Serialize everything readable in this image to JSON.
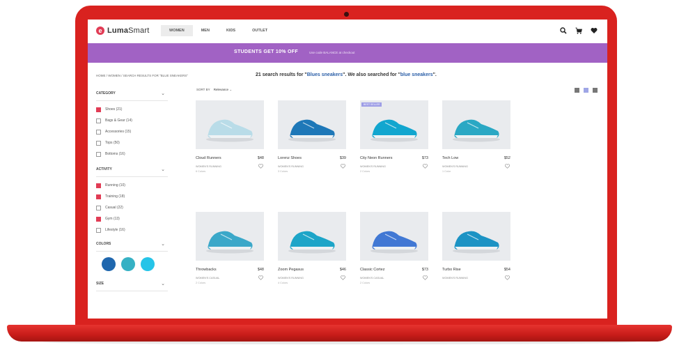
{
  "site": {
    "logo_initial": "e",
    "logo_text_bold": "Luma",
    "logo_text": "Smart",
    "nav": [
      {
        "label": "Women",
        "active": true
      },
      {
        "label": "Men",
        "active": false
      },
      {
        "label": "Kids",
        "active": false
      },
      {
        "label": "Outlet",
        "active": false
      }
    ],
    "icons": [
      "search-icon",
      "cart-icon",
      "heart-icon"
    ]
  },
  "promo": {
    "title": "STUDENTS GET 10% OFF",
    "subtitle": "Use code BALANCE at checkout"
  },
  "breadcrumb": "HOME / WOMEN / SEARCH RESULTS FOR \"BLUE SNEAKERS\"",
  "results": {
    "prefix": "21 search results for \"",
    "query": "Blues sneakers",
    "middle": "\". We also searched for \"",
    "suggest": "blue sneakers",
    "suffix": "\"."
  },
  "sort": {
    "label": "SORT BY",
    "value": "Relevance"
  },
  "filters": {
    "category": {
      "title": "Category",
      "options": [
        {
          "label": "Shoes (21)",
          "checked": true
        },
        {
          "label": "Bags & Gear (14)",
          "checked": false
        },
        {
          "label": "Accessories (15)",
          "checked": false
        },
        {
          "label": "Tops (50)",
          "checked": false
        },
        {
          "label": "Bottoms (16)",
          "checked": false
        }
      ]
    },
    "activity": {
      "title": "Activity",
      "options": [
        {
          "label": "Running (10)",
          "checked": true
        },
        {
          "label": "Training (18)",
          "checked": true
        },
        {
          "label": "Casual (22)",
          "checked": false
        },
        {
          "label": "Gym (13)",
          "checked": true
        },
        {
          "label": "Lifestyle (16)",
          "checked": false
        }
      ]
    },
    "colors": {
      "title": "Colors",
      "values": [
        "#1f67ae",
        "#36b1c4",
        "#26c4e8"
      ]
    },
    "size": {
      "title": "Size"
    }
  },
  "products": [
    {
      "name": "Cloud Runners",
      "price": "$48",
      "sub": "Women's Running",
      "meta": "6 Colors",
      "badge": ""
    },
    {
      "name": "Lorenz Shoes",
      "price": "$39",
      "sub": "Women's Running",
      "meta": "3 Colors",
      "badge": ""
    },
    {
      "name": "City Neon Runners",
      "price": "$73",
      "sub": "Women's Running",
      "meta": "2 Colors",
      "badge": "Best Seller"
    },
    {
      "name": "Tech Low",
      "price": "$52",
      "sub": "Women's Running",
      "meta": "1 Color",
      "badge": ""
    },
    {
      "name": "Throwbacks",
      "price": "$48",
      "sub": "Women's Casual",
      "meta": "2 Colors",
      "badge": ""
    },
    {
      "name": "Zoom Pegasus",
      "price": "$46",
      "sub": "Women's Running",
      "meta": "4 Colors",
      "badge": ""
    },
    {
      "name": "Classic Cortez",
      "price": "$73",
      "sub": "Women's Casual",
      "meta": "2 Colors",
      "badge": ""
    },
    {
      "name": "Turbo Rise",
      "price": "$54",
      "sub": "Women's Running",
      "meta": "",
      "badge": ""
    }
  ],
  "colors": {
    "accent": "#e13c55",
    "promo": "#a162c4",
    "laptop": "#d9221f",
    "link": "#2b5fa8"
  }
}
